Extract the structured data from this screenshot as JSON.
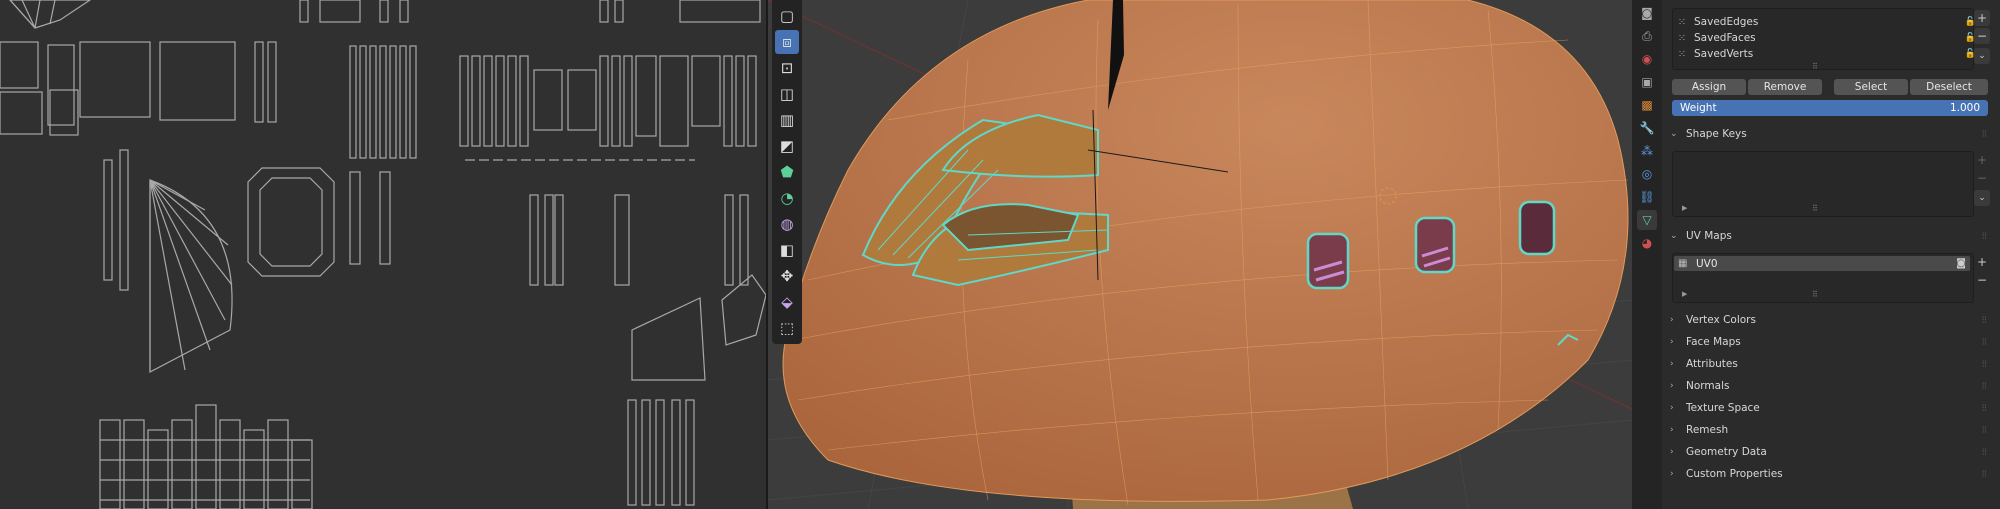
{
  "toolbar": {
    "tools": [
      {
        "icon": "select-cube-icon"
      },
      {
        "icon": "extrude-icon"
      },
      {
        "icon": "inset-icon"
      },
      {
        "icon": "bevel-icon"
      },
      {
        "icon": "loop-cut-icon"
      },
      {
        "icon": "knife-icon"
      },
      {
        "icon": "poly-build-icon"
      },
      {
        "icon": "spin-icon"
      },
      {
        "icon": "smooth-icon"
      },
      {
        "icon": "edge-slide-icon"
      },
      {
        "icon": "shrink-fatten-icon"
      },
      {
        "icon": "shear-icon"
      },
      {
        "icon": "rip-icon"
      }
    ]
  },
  "props": {
    "vertex_groups": [
      {
        "name": "SavedEdges"
      },
      {
        "name": "SavedFaces"
      },
      {
        "name": "SavedVerts"
      }
    ],
    "buttons": {
      "assign": "Assign",
      "remove": "Remove",
      "select": "Select",
      "deselect": "Deselect"
    },
    "weight": {
      "label": "Weight",
      "value": "1.000"
    },
    "shape_keys": {
      "title": "Shape Keys"
    },
    "uv_maps": {
      "title": "UV Maps",
      "items": [
        {
          "name": "UV0"
        }
      ]
    },
    "sections": [
      {
        "title": "Vertex Colors"
      },
      {
        "title": "Face Maps"
      },
      {
        "title": "Attributes"
      },
      {
        "title": "Normals"
      },
      {
        "title": "Texture Space"
      },
      {
        "title": "Remesh"
      },
      {
        "title": "Geometry Data"
      },
      {
        "title": "Custom Properties"
      }
    ]
  },
  "colors": {
    "accent": "#4772b3",
    "mesh": "#d98c52",
    "selection": "#5fd8c8"
  }
}
